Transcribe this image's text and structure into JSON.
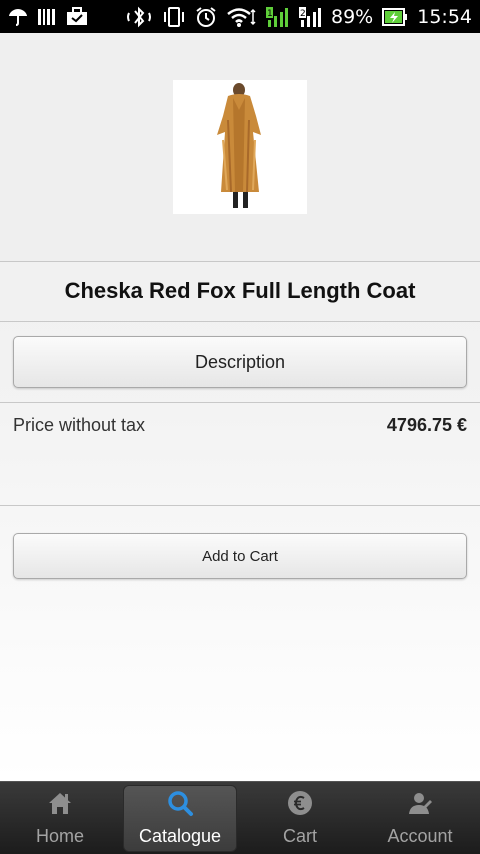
{
  "status_bar": {
    "battery_percent": "89%",
    "time": "15:54",
    "icons": [
      "umbrella-icon",
      "barcode-icon",
      "briefcase-icon",
      "bluetooth-icon",
      "vibrate-icon",
      "alarm-icon",
      "wifi-icon",
      "signal-icon-1",
      "signal-icon-2",
      "battery-charging-icon"
    ]
  },
  "product": {
    "image_icon": "product-image-fur-coat",
    "title": "Cheska Red Fox Full Length Coat",
    "description_label": "Description",
    "price_label": "Price without tax",
    "price_value": "4796.75 €",
    "add_to_cart_label": "Add to Cart"
  },
  "tabs": [
    {
      "label": "Home",
      "icon": "home-icon",
      "active": false
    },
    {
      "label": "Catalogue",
      "icon": "search-icon",
      "active": true
    },
    {
      "label": "Cart",
      "icon": "euro-icon",
      "active": false
    },
    {
      "label": "Account",
      "icon": "account-icon",
      "active": false
    }
  ],
  "colors": {
    "accent_blue": "#2d8fe0",
    "green_battery": "#5fcf3a"
  }
}
